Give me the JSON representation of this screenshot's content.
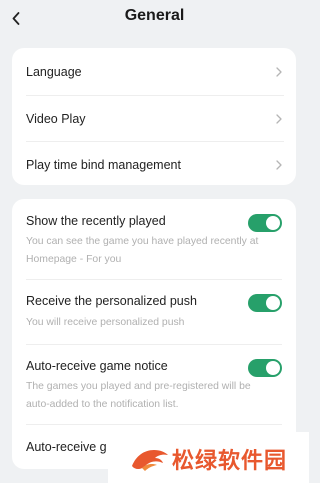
{
  "header": {
    "title": "General",
    "back_icon": "chevron-left-icon"
  },
  "nav_items": [
    {
      "label": "Language"
    },
    {
      "label": "Video Play"
    },
    {
      "label": "Play time bind management"
    }
  ],
  "settings": [
    {
      "label": "Show the recently played",
      "description": "You can see the game you have played recently at Homepage - For you",
      "enabled": true
    },
    {
      "label": "Receive the personalized push",
      "description": "You will receive personalized push",
      "enabled": true
    },
    {
      "label": "Auto-receive game notice",
      "description": "The games you played and pre-registered will be auto-added to the notification list.",
      "enabled": true
    },
    {
      "label": "Auto-receive g"
    }
  ],
  "watermark": {
    "text": "松绿软件园"
  },
  "colors": {
    "background": "#eff1f3",
    "toggle_on": "#27a06a",
    "watermark": "#e8582e"
  }
}
